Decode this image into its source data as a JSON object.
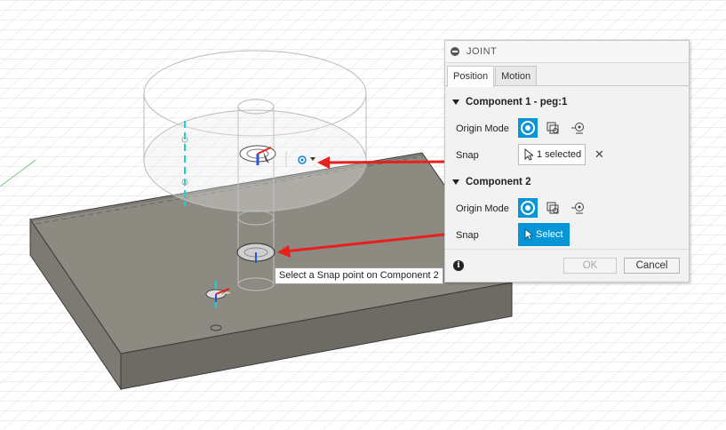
{
  "dialog": {
    "title": "JOINT",
    "tabs": [
      {
        "label": "Position",
        "active": true
      },
      {
        "label": "Motion",
        "active": false
      }
    ],
    "component1": {
      "heading": "Component 1 - peg:1",
      "origin_mode_label": "Origin Mode",
      "snap_label": "Snap",
      "snap_value": "1 selected",
      "clear_icon": "close-icon"
    },
    "component2": {
      "heading": "Component 2",
      "origin_mode_label": "Origin Mode",
      "snap_label": "Snap",
      "snap_value": "Select"
    },
    "buttons": {
      "ok": "OK",
      "cancel": "Cancel"
    },
    "info_icon": "i"
  },
  "tooltip": "Select a Snap point on Component 2",
  "colors": {
    "accent": "#0696d7",
    "arrow": "#e8201c",
    "axis": "#19d3d3",
    "block_top": "#8d8a82",
    "block_front": "#6e6b64"
  }
}
